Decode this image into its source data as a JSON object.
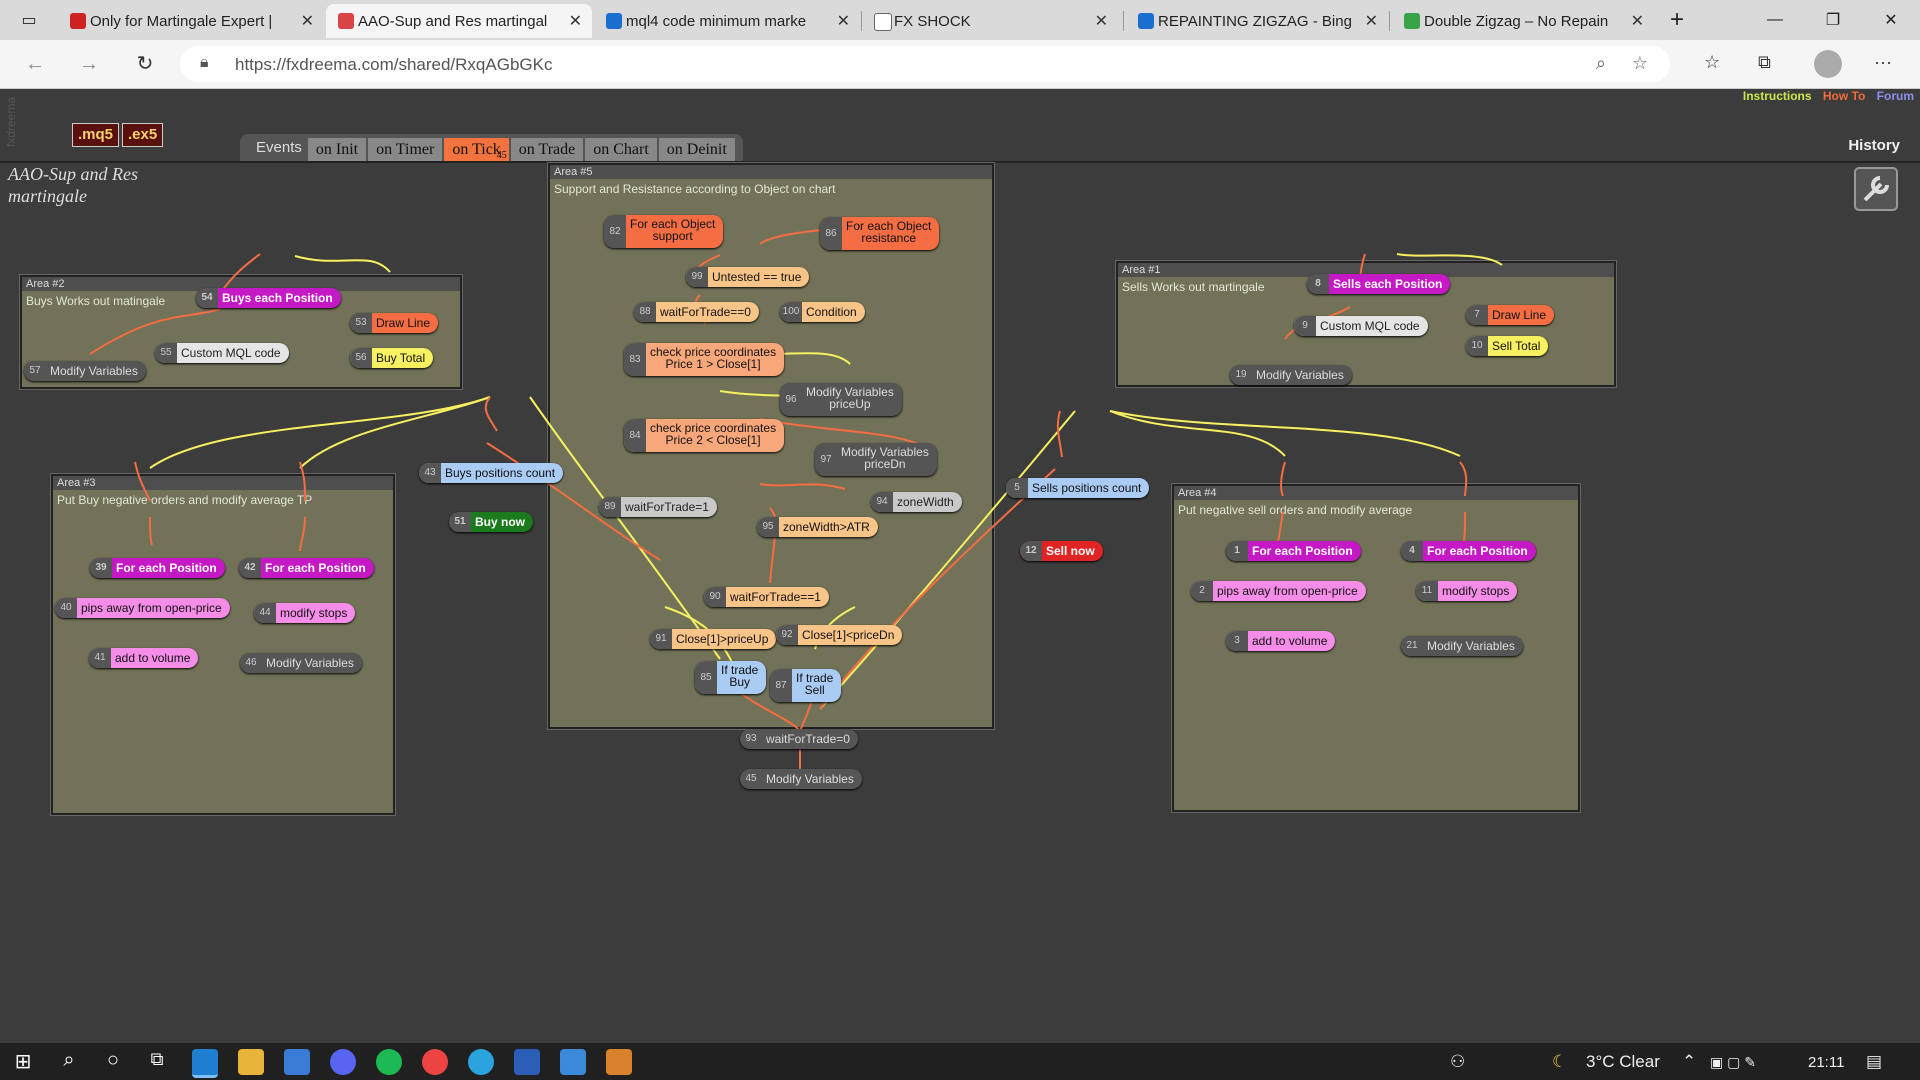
{
  "browser": {
    "tabs": [
      {
        "title": "Only for Martingale Expert |",
        "fav_color": "#cc2222"
      },
      {
        "title": "AAO-Sup and Res martingal",
        "fav_color": "#d94444"
      },
      {
        "title": "mql4 code minimum marke",
        "fav_color": "#1b6fd0"
      },
      {
        "title": "FX SHOCK",
        "fav_color": "#666666"
      },
      {
        "title": "REPAINTING ZIGZAG - Bing",
        "fav_color": "#1b6fd0"
      },
      {
        "title": "Double Zigzag – No Repain",
        "fav_color": "#3aa34a"
      }
    ],
    "close_glyph": "✕",
    "new_tab_glyph": "+",
    "url": "https://fxdreema.com/shared/RxqAGbGKc",
    "window": {
      "minimize": "—",
      "maximize": "❐",
      "close": "✕"
    }
  },
  "page": {
    "top_links": {
      "instructions": "Instructions",
      "how_to": "How To",
      "forum": "Forum"
    },
    "file_buttons": [
      ".mq5",
      ".ex5"
    ],
    "side_text": "fxdreema",
    "events_label": "Events",
    "event_tabs": [
      "on Init",
      "on Timer",
      "on Tick",
      "on Trade",
      "on Chart",
      "on Deinit"
    ],
    "active_tab_badge": "45",
    "project_name": "AAO-Sup and Res martingale",
    "history": "History",
    "areas": [
      {
        "title": "Area #2",
        "desc": "Buys Works out matingale"
      },
      {
        "title": "Area #3",
        "desc": "Put Buy negative orders and modify average TP"
      },
      {
        "title": "Area #5",
        "desc": "Support and Resistance according to Object on chart"
      },
      {
        "title": "Area #1",
        "desc": "Sells Works out martingale"
      },
      {
        "title": "Area #4",
        "desc": "Put negative sell orders and modify average"
      }
    ],
    "blocks": {
      "b54": {
        "id": "54",
        "label": "Buys each Position"
      },
      "b53": {
        "id": "53",
        "label": "Draw Line"
      },
      "b55": {
        "id": "55",
        "label": "Custom MQL code"
      },
      "b56": {
        "id": "56",
        "label": "Buy Total"
      },
      "b57": {
        "id": "57",
        "label": "Modify Variables"
      },
      "b43": {
        "id": "43",
        "label": "Buys positions count"
      },
      "b51": {
        "id": "51",
        "label": "Buy now"
      },
      "b39": {
        "id": "39",
        "label": "For each Position"
      },
      "b42": {
        "id": "42",
        "label": "For each Position"
      },
      "b40": {
        "id": "40",
        "label": "pips away from open-price"
      },
      "b44": {
        "id": "44",
        "label": "modify stops"
      },
      "b41": {
        "id": "41",
        "label": "add to volume"
      },
      "b46": {
        "id": "46",
        "label": "Modify Variables"
      },
      "b82": {
        "id": "82",
        "line1": "For each Object",
        "line2": "support"
      },
      "b86": {
        "id": "86",
        "line1": "For each Object",
        "line2": "resistance"
      },
      "b99": {
        "id": "99",
        "label": "Untested == true"
      },
      "b88": {
        "id": "88",
        "label": "waitForTrade==0"
      },
      "b100": {
        "id": "100",
        "label": "Condition"
      },
      "b83": {
        "id": "83",
        "line1": "check price coordinates",
        "line2": "Price 1 > Close[1]"
      },
      "b96": {
        "id": "96",
        "line1": "Modify Variables",
        "line2": "priceUp"
      },
      "b84": {
        "id": "84",
        "line1": "check price coordinates",
        "line2": "Price 2 < Close[1]"
      },
      "b97": {
        "id": "97",
        "line1": "Modify Variables",
        "line2": "priceDn"
      },
      "b89": {
        "id": "89",
        "label": "waitForTrade=1"
      },
      "b94": {
        "id": "94",
        "label": "zoneWidth"
      },
      "b95": {
        "id": "95",
        "label": "zoneWidth>ATR"
      },
      "b90": {
        "id": "90",
        "label": "waitForTrade==1"
      },
      "b91": {
        "id": "91",
        "label": "Close[1]>priceUp"
      },
      "b92": {
        "id": "92",
        "label": "Close[1]<priceDn"
      },
      "b85": {
        "id": "85",
        "line1": "If trade",
        "line2": "Buy"
      },
      "b87": {
        "id": "87",
        "line1": "If trade",
        "line2": "Sell"
      },
      "b93": {
        "id": "93",
        "label": "waitForTrade=0"
      },
      "b45": {
        "id": "45",
        "label": "Modify Variables"
      },
      "b8": {
        "id": "8",
        "label": "Sells each Position"
      },
      "b9": {
        "id": "9",
        "label": "Custom MQL code"
      },
      "b7": {
        "id": "7",
        "label": "Draw Line"
      },
      "b10": {
        "id": "10",
        "label": "Sell Total"
      },
      "b19": {
        "id": "19",
        "label": "Modify Variables"
      },
      "b5": {
        "id": "5",
        "label": "Sells positions count"
      },
      "b12": {
        "id": "12",
        "label": "Sell now"
      },
      "b1": {
        "id": "1",
        "label": "For each Position"
      },
      "b4": {
        "id": "4",
        "label": "For each Position"
      },
      "b2": {
        "id": "2",
        "label": "pips away from open-price"
      },
      "b11": {
        "id": "11",
        "label": "modify stops"
      },
      "b3": {
        "id": "3",
        "label": "add to volume"
      },
      "b21": {
        "id": "21",
        "label": "Modify Variables"
      }
    }
  },
  "taskbar": {
    "weather": "3°C  Clear",
    "time": "21:11"
  }
}
